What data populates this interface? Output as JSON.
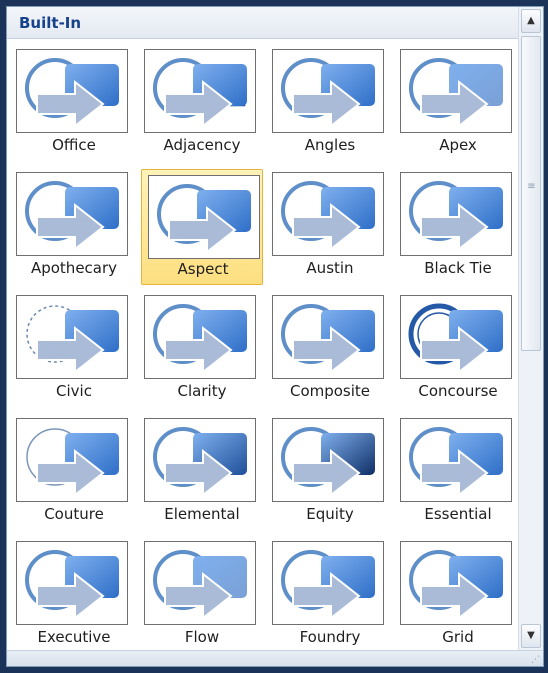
{
  "section": {
    "title": "Built-In"
  },
  "themes": [
    {
      "name": "Office",
      "variant": "plain"
    },
    {
      "name": "Adjacency",
      "variant": "frame"
    },
    {
      "name": "Angles",
      "variant": "plain"
    },
    {
      "name": "Apex",
      "variant": "light"
    },
    {
      "name": "Apothecary",
      "variant": "double"
    },
    {
      "name": "Aspect",
      "variant": "plain",
      "selected": true
    },
    {
      "name": "Austin",
      "variant": "plain"
    },
    {
      "name": "Black Tie",
      "variant": "plain"
    },
    {
      "name": "Civic",
      "variant": "dashed"
    },
    {
      "name": "Clarity",
      "variant": "plain"
    },
    {
      "name": "Composite",
      "variant": "plain"
    },
    {
      "name": "Concourse",
      "variant": "bold"
    },
    {
      "name": "Couture",
      "variant": "thin"
    },
    {
      "name": "Elemental",
      "variant": "dark"
    },
    {
      "name": "Equity",
      "variant": "stripe"
    },
    {
      "name": "Essential",
      "variant": "plain"
    },
    {
      "name": "Executive",
      "variant": "plain"
    },
    {
      "name": "Flow",
      "variant": "light"
    },
    {
      "name": "Foundry",
      "variant": "plain"
    },
    {
      "name": "Grid",
      "variant": "plain"
    }
  ],
  "colors": {
    "accent": "#2f6fc8",
    "accent_light": "#7fb0ee",
    "arrow": "#aabbd8",
    "selected_bg": "#fddf80"
  },
  "icons": {
    "scroll_up": "up-arrow-icon",
    "scroll_down": "down-arrow-icon",
    "grip": "scroll-grip-icon",
    "resize": "resize-grip-icon"
  }
}
